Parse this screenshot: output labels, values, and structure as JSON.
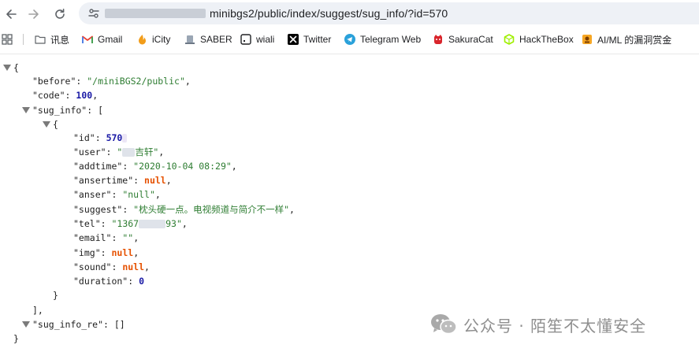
{
  "browser": {
    "url_visible": "minibgs2/public/index/suggest/sug_info/?id=570",
    "colors": {
      "omnibox_bg": "#eef1f6",
      "redaction": "#c9ced6"
    }
  },
  "bookmarks": [
    {
      "label": "讯息",
      "icon": "folder-icon"
    },
    {
      "label": "Gmail",
      "icon": "gmail-icon"
    },
    {
      "label": "iCity",
      "icon": "icity-icon"
    },
    {
      "label": "SABER",
      "icon": "saber-icon"
    },
    {
      "label": "wiali",
      "icon": "wiali-icon"
    },
    {
      "label": "Twitter",
      "icon": "x-icon"
    },
    {
      "label": "Telegram Web",
      "icon": "telegram-icon"
    },
    {
      "label": "SakuraCat",
      "icon": "sakuracat-icon"
    },
    {
      "label": "HackTheBox",
      "icon": "hackthebox-icon"
    },
    {
      "label": "AI/ML 的漏洞赏金",
      "icon": "bounty-icon"
    }
  ],
  "json_view": {
    "open_brace": "{",
    "before_key": "\"before\"",
    "before_val": "\"/miniBGS2/public\"",
    "code_key": "\"code\"",
    "code_val": "100",
    "sug_info_key": "\"sug_info\"",
    "open_bracket": "[",
    "item_open": "{",
    "id_key": "\"id\"",
    "id_val": "570",
    "user_key": "\"user\"",
    "user_val_prefix": "\"",
    "user_val_visible": "吉轩\"",
    "addtime_key": "\"addtime\"",
    "addtime_val": "\"2020-10-04 08:29\"",
    "ansertime_key": "\"ansertime\"",
    "ansertime_val": "null",
    "anser_key": "\"anser\"",
    "anser_val": "\"null\"",
    "suggest_key": "\"suggest\"",
    "suggest_val": "\"枕头硬一点。电视频道与简介不一样\"",
    "tel_key": "\"tel\"",
    "tel_val_prefix": "\"1367",
    "tel_val_suffix": "93\"",
    "email_key": "\"email\"",
    "email_val": "\"\"",
    "img_key": "\"img\"",
    "img_val": "null",
    "sound_key": "\"sound\"",
    "sound_val": "null",
    "duration_key": "\"duration\"",
    "duration_val": "0",
    "item_close": "}",
    "close_bracket": "],",
    "sug_info_re_key": "\"sug_info_re\"",
    "sug_info_re_val": "[]",
    "close_brace": "}"
  },
  "watermark": {
    "text": "公众号 · 陌笙不太懂安全"
  }
}
